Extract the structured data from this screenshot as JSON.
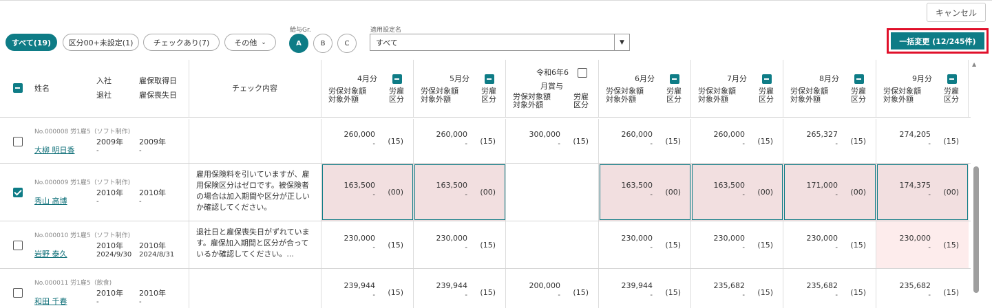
{
  "toolbar": {
    "cancel_label": "キャンセル",
    "bulk_label": "一括変更 (12/245件)"
  },
  "filters": {
    "chips": [
      {
        "label": "すべて(19)",
        "active": true
      },
      {
        "label": "区分00+未設定(1)"
      },
      {
        "label": "チェックあり(7)"
      },
      {
        "label": "その他"
      }
    ],
    "pay_group_label": "給与Gr.",
    "pay_groups": [
      "A",
      "B",
      "C"
    ],
    "setting_label": "適用設定名",
    "setting_value": "すべて"
  },
  "colors": {
    "accent": "#0e7c86",
    "highlight_bg": "#f2dfe0",
    "alert_border": "#e0102a"
  },
  "header": {
    "name": "姓名",
    "join": "入社",
    "leave": "退社",
    "ins_get": "雇保取得日",
    "ins_lost": "雇保喪失日",
    "check": "チェック内容",
    "amount_line1": "労保対象額",
    "amount_line2": "対象外額",
    "kubun_line1": "労雇",
    "kubun_line2": "区分",
    "months": [
      "4月分",
      "5月分",
      "令和6年6",
      "6月分",
      "7月分",
      "8月分",
      "9月分"
    ],
    "bonus_suffix": "月賞与"
  },
  "rows": [
    {
      "meta": "No.000008 労1雇5（ソフト制作)",
      "name": "大柳 明日香",
      "join": "2009年",
      "leave": "-",
      "ins_get": "2009年",
      "ins_lost": "-",
      "note": "",
      "cells": [
        {
          "amt": "260,000",
          "dash": "-",
          "kbn": "(15)"
        },
        {
          "amt": "260,000",
          "dash": "-",
          "kbn": "(15)"
        },
        {
          "amt": "300,000",
          "dash": "-",
          "kbn": "(15)"
        },
        {
          "amt": "260,000",
          "dash": "-",
          "kbn": "(15)"
        },
        {
          "amt": "260,000",
          "dash": "-",
          "kbn": "(15)"
        },
        {
          "amt": "265,327",
          "dash": "-",
          "kbn": "(15)"
        },
        {
          "amt": "274,205",
          "dash": "-",
          "kbn": "(15)"
        }
      ]
    },
    {
      "meta": "No.000009 労1雇5（ソフト制作)",
      "name": "秀山 高博",
      "join": "2010年",
      "leave": "-",
      "ins_get": "2010年",
      "ins_lost": "-",
      "note": "雇用保険料を引いていますが、雇用保険区分はゼロです。被保険者の場合は加入期間や区分が正しいか確認してください。",
      "checked": true,
      "cells": [
        {
          "amt": "163,500",
          "dash": "-",
          "kbn": "(00)",
          "hl": true
        },
        {
          "amt": "163,500",
          "dash": "-",
          "kbn": "(00)",
          "hl": true
        },
        {
          "amt": "",
          "dash": "",
          "kbn": ""
        },
        {
          "amt": "163,500",
          "dash": "-",
          "kbn": "(00)",
          "hl": true
        },
        {
          "amt": "163,500",
          "dash": "-",
          "kbn": "(00)",
          "hl": true
        },
        {
          "amt": "171,000",
          "dash": "-",
          "kbn": "(00)",
          "hl": true
        },
        {
          "amt": "174,375",
          "dash": "-",
          "kbn": "(00)",
          "hl": true
        }
      ]
    },
    {
      "meta": "No.000010 労1雇5（ソフト制作)",
      "name": "岩野 泰久",
      "join": "2010年",
      "leave": "2024/9/30",
      "ins_get": "2010年",
      "ins_lost": "2024/8/31",
      "note": "退社日と雇保喪失日がずれています。雇保加入期間と区分が合っているか確認してください。...",
      "cells": [
        {
          "amt": "230,000",
          "dash": "-",
          "kbn": "(15)"
        },
        {
          "amt": "230,000",
          "dash": "-",
          "kbn": "(15)"
        },
        {
          "amt": "",
          "dash": "",
          "kbn": ""
        },
        {
          "amt": "230,000",
          "dash": "-",
          "kbn": "(15)"
        },
        {
          "amt": "230,000",
          "dash": "-",
          "kbn": "(15)"
        },
        {
          "amt": "230,000",
          "dash": "-",
          "kbn": "(15)"
        },
        {
          "amt": "230,000",
          "dash": "-",
          "kbn": "(15)",
          "soft": true
        }
      ]
    },
    {
      "meta": "No.000011 労1雇5（飲食)",
      "name": "和田 千春",
      "join": "2010年",
      "leave": "-",
      "ins_get": "2010年",
      "ins_lost": "-",
      "note": "",
      "cells": [
        {
          "amt": "239,944",
          "dash": "-",
          "kbn": "(15)"
        },
        {
          "amt": "239,944",
          "dash": "-",
          "kbn": "(15)"
        },
        {
          "amt": "200,000",
          "dash": "-",
          "kbn": "(15)"
        },
        {
          "amt": "239,944",
          "dash": "-",
          "kbn": "(15)"
        },
        {
          "amt": "235,682",
          "dash": "-",
          "kbn": "(15)"
        },
        {
          "amt": "235,682",
          "dash": "-",
          "kbn": "(15)"
        },
        {
          "amt": "235,682",
          "dash": "-",
          "kbn": "(15)"
        }
      ]
    }
  ]
}
